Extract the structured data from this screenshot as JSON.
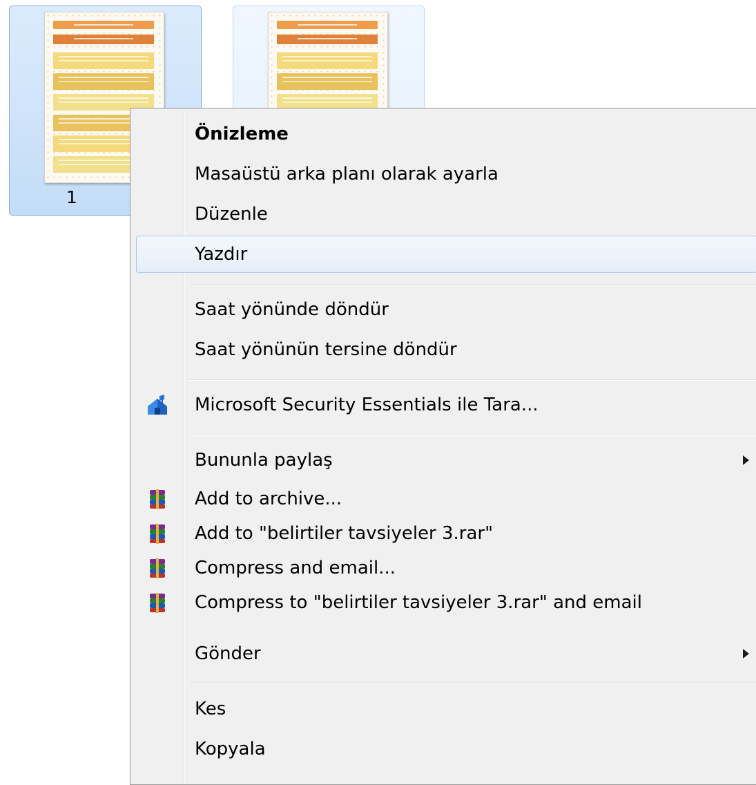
{
  "files": [
    {
      "name": "1",
      "state": "selected"
    },
    {
      "name": "",
      "state": "hover"
    }
  ],
  "menu": {
    "items": [
      {
        "id": "preview",
        "label": "Önizleme",
        "bold": true
      },
      {
        "id": "set-desktop-background",
        "label": "Masaüstü arka planı olarak ayarla"
      },
      {
        "id": "edit",
        "label": "Düzenle"
      },
      {
        "id": "print",
        "label": "Yazdır",
        "highlighted": true
      },
      {
        "id": "rotate-clockwise",
        "label": "Saat yönünde döndür"
      },
      {
        "id": "rotate-counterclockwise",
        "label": "Saat yönünün tersine döndür"
      },
      {
        "id": "mse-scan",
        "label": "Microsoft Security Essentials ile Tara...",
        "icon": "security-essentials-icon"
      },
      {
        "id": "share-with",
        "label": "Bununla paylaş",
        "submenu": true
      },
      {
        "id": "add-to-archive",
        "label": "Add to archive...",
        "icon": "winrar-icon"
      },
      {
        "id": "add-to-rar",
        "label": "Add to \"belirtiler tavsiyeler 3.rar\"",
        "icon": "winrar-icon"
      },
      {
        "id": "compress-email",
        "label": "Compress and email...",
        "icon": "winrar-icon"
      },
      {
        "id": "compress-rar-email",
        "label": "Compress to \"belirtiler tavsiyeler 3.rar\" and email",
        "icon": "winrar-icon"
      },
      {
        "id": "send-to",
        "label": "Gönder",
        "submenu": true
      },
      {
        "id": "cut",
        "label": "Kes"
      },
      {
        "id": "copy",
        "label": "Kopyala"
      }
    ]
  },
  "colors": {
    "menu_background": "#f0f0f0",
    "highlight_border": "#a8c8ee",
    "selection_background": "#c3dcf8",
    "thumbnail_accent": "#ef9c4b"
  }
}
